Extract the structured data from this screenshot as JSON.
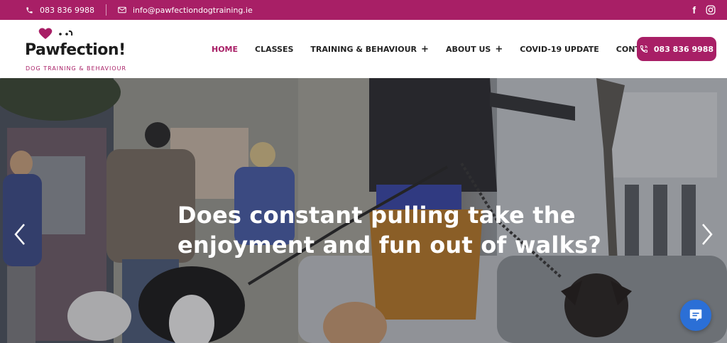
{
  "topbar": {
    "phone": "083 836 9988",
    "email": "info@pawfectiondogtraining.ie",
    "social": [
      "facebook-icon",
      "instagram-icon"
    ]
  },
  "logo": {
    "name": "Pawfection!",
    "tagline": "DOG TRAINING & BEHAVIOUR"
  },
  "nav": {
    "items": [
      {
        "label": "HOME",
        "active": true
      },
      {
        "label": "CLASSES"
      },
      {
        "label": "TRAINING & BEHAVIOUR",
        "has_submenu": true
      },
      {
        "label": "ABOUT US",
        "has_submenu": true
      },
      {
        "label": "COVID-19 UPDATE"
      },
      {
        "label": "CONTACT"
      }
    ],
    "call_button": "083 836 9988"
  },
  "hero": {
    "headline": "Does constant pulling take the enjoyment and fun out of walks?"
  },
  "colors": {
    "brand": "#a81f66",
    "chat": "#2b6fd6"
  }
}
